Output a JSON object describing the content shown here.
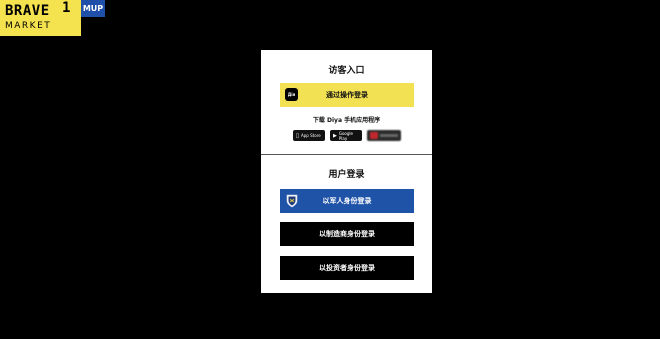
{
  "logo": {
    "brand_line1": "BRAVE",
    "brand_sup": "1",
    "brand_line2": "MARKET",
    "badge": "MUP",
    "bg_color": "#f5e24f",
    "badge_color": "#1f4fa8"
  },
  "guest": {
    "title": "访客入口",
    "diia_button_label": "通过操作登录",
    "diia_icon_text": "Дія",
    "download_text": "下载 Diya 手机应用程序",
    "app_store_label": "App Store",
    "google_play_label": "Google Play"
  },
  "user": {
    "title": "用户登录",
    "military_label": "以军人身份登录",
    "manufacturer_label": "以制造商身份登录",
    "investor_label": "以投资者身份登录"
  },
  "colors": {
    "background": "#000000",
    "panel": "#ffffff",
    "diia_yellow": "#f2e152",
    "military_blue": "#1f53a8",
    "dark_button": "#000000"
  }
}
